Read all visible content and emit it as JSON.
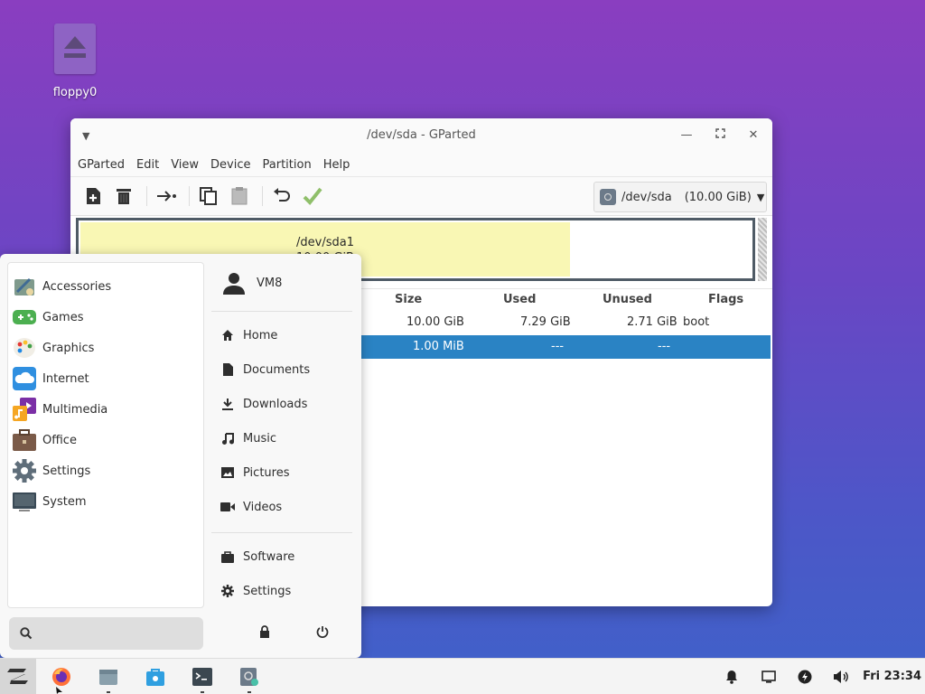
{
  "desktop": {
    "icon_label": "floppy0"
  },
  "window": {
    "title": "/dev/sda - GParted",
    "menu": [
      "GParted",
      "Edit",
      "View",
      "Device",
      "Partition",
      "Help"
    ],
    "device": {
      "name": "/dev/sda",
      "capacity": "(10.00 GiB)"
    },
    "diskmap": {
      "partition_name": "/dev/sda1",
      "partition_size": "10.00 GiB",
      "used_fraction": 0.729
    },
    "table": {
      "columns": [
        "Size",
        "Used",
        "Unused",
        "Flags"
      ],
      "rows": [
        {
          "size": "10.00 GiB",
          "used": "7.29 GiB",
          "unused": "2.71 GiB",
          "flags": "boot",
          "selected": false
        },
        {
          "size": "1.00 MiB",
          "used": "---",
          "unused": "---",
          "flags": "",
          "selected": true
        }
      ]
    }
  },
  "startmenu": {
    "categories": [
      "Accessories",
      "Games",
      "Graphics",
      "Internet",
      "Multimedia",
      "Office",
      "Settings",
      "System"
    ],
    "user": "VM8",
    "places": [
      "Home",
      "Documents",
      "Downloads",
      "Music",
      "Pictures",
      "Videos"
    ],
    "apps": [
      "Software",
      "Settings"
    ],
    "search_value": ""
  },
  "taskbar": {
    "clock": "Fri 23:34"
  },
  "colors": {
    "selection": "#2a83c4",
    "partition_fill": "#f9f7b4",
    "desktop_top": "#8a3ec0",
    "desktop_bottom": "#3f62c9"
  }
}
